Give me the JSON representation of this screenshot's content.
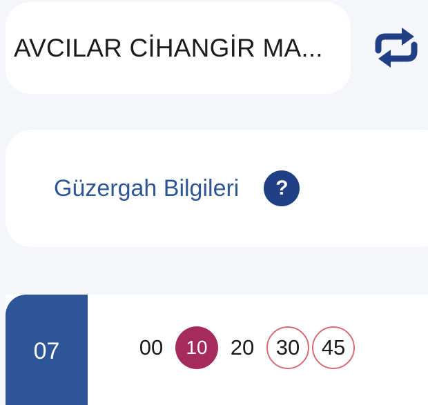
{
  "route": {
    "name": "AVCILAR CİHANGİR MA..."
  },
  "swap_icon": "repeat-arrows-icon",
  "info": {
    "label": "Güzergah Bilgileri",
    "help_glyph": "?"
  },
  "schedule": {
    "hour": "07",
    "minutes": [
      {
        "value": "00",
        "style": "plain"
      },
      {
        "value": "10",
        "style": "current"
      },
      {
        "value": "20",
        "style": "plain"
      },
      {
        "value": "30",
        "style": "outlined"
      },
      {
        "value": "45",
        "style": "outlined"
      }
    ]
  },
  "colors": {
    "primary": "#2d5597",
    "link": "#2d5694",
    "current_minute": "#a62b5d",
    "outline_minute": "#d66b73",
    "background": "#f5f6fa"
  }
}
